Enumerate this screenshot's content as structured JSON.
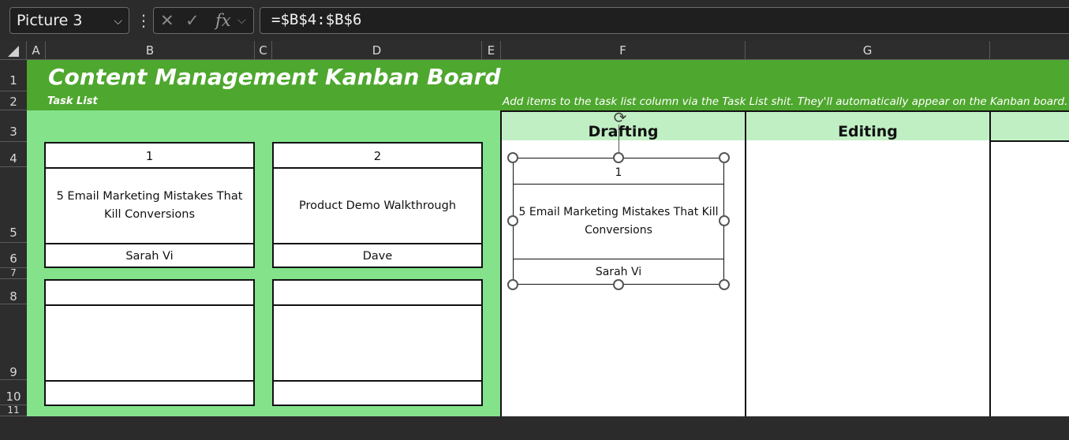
{
  "formula_bar": {
    "name_box": "Picture 3",
    "cancel_icon": "✕",
    "enter_icon": "✓",
    "fx_label": "fx",
    "formula": "=$B$4:$B$6"
  },
  "columns": [
    "A",
    "B",
    "C",
    "D",
    "E",
    "F",
    "G"
  ],
  "rows": [
    "1",
    "2",
    "3",
    "4",
    "5",
    "6",
    "7",
    "8",
    "9",
    "10",
    "11"
  ],
  "sheet": {
    "title": "Content Management Kanban Board",
    "task_list_label": "Task List",
    "note": "Add items to the task list column via the Task List shit. They'll automatically appear on the Kanban board.",
    "board_columns": [
      "Drafting",
      "Editing"
    ]
  },
  "task_cards": [
    {
      "number": "1",
      "title": "5 Email Marketing Mistakes That Kill Conversions",
      "owner": "Sarah Vi"
    },
    {
      "number": "2",
      "title": "Product Demo Walkthrough",
      "owner": "Dave"
    },
    {
      "number": "",
      "title": "",
      "owner": ""
    },
    {
      "number": "",
      "title": "",
      "owner": ""
    }
  ],
  "selected_picture": {
    "number": "1",
    "title": "5 Email Marketing Mistakes That Kill Conversions",
    "owner": "Sarah Vi"
  },
  "colors": {
    "banner": "#4ea72e",
    "task_area": "#84e28a",
    "column_header": "#c1efc4"
  }
}
